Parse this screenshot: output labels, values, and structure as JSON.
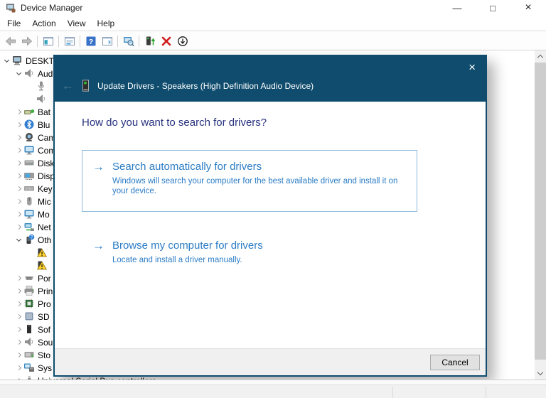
{
  "titlebar": {
    "title": "Device Manager",
    "app_icon": "device-manager-icon",
    "minimize_glyph": "—",
    "maximize_glyph": "□",
    "close_glyph": "×"
  },
  "menubar": {
    "items": [
      "File",
      "Action",
      "View",
      "Help"
    ]
  },
  "toolbar": {
    "buttons": [
      {
        "icon": "back-arrow-icon",
        "disabled": true
      },
      {
        "icon": "forward-arrow-icon",
        "disabled": true
      },
      {
        "sep": true
      },
      {
        "icon": "console-tree-icon"
      },
      {
        "sep": true
      },
      {
        "icon": "properties-icon"
      },
      {
        "sep": true
      },
      {
        "icon": "help-icon"
      },
      {
        "icon": "action-pane-icon"
      },
      {
        "sep": true
      },
      {
        "icon": "scan-hardware-icon"
      },
      {
        "sep": true
      },
      {
        "icon": "update-driver-icon"
      },
      {
        "icon": "uninstall-device-icon"
      },
      {
        "icon": "disable-device-icon"
      }
    ]
  },
  "tree": {
    "items": [
      {
        "label": "DESKTO",
        "icon": "computer-icon",
        "depth": 0,
        "expander": "open"
      },
      {
        "label": "Aud",
        "icon": "speaker-icon",
        "depth": 1,
        "expander": "open"
      },
      {
        "label": "",
        "icon": "microphone-icon",
        "depth": 2,
        "expander": "none"
      },
      {
        "label": "",
        "icon": "speaker-icon",
        "depth": 2,
        "expander": "none"
      },
      {
        "label": "Bat",
        "icon": "battery-icon",
        "depth": 1,
        "expander": "closed"
      },
      {
        "label": "Blu",
        "icon": "bluetooth-icon",
        "depth": 1,
        "expander": "closed"
      },
      {
        "label": "Cam",
        "icon": "camera-icon",
        "depth": 1,
        "expander": "closed"
      },
      {
        "label": "Com",
        "icon": "monitor-icon",
        "depth": 1,
        "expander": "closed"
      },
      {
        "label": "Disk",
        "icon": "disk-icon",
        "depth": 1,
        "expander": "closed"
      },
      {
        "label": "Disp",
        "icon": "display-adapter-icon",
        "depth": 1,
        "expander": "closed"
      },
      {
        "label": "Key",
        "icon": "keyboard-icon",
        "depth": 1,
        "expander": "closed"
      },
      {
        "label": "Mic",
        "icon": "mouse-icon",
        "depth": 1,
        "expander": "closed"
      },
      {
        "label": "Mo",
        "icon": "monitor-icon",
        "depth": 1,
        "expander": "closed"
      },
      {
        "label": "Net",
        "icon": "network-icon",
        "depth": 1,
        "expander": "closed"
      },
      {
        "label": "Oth",
        "icon": "other-device-icon",
        "depth": 1,
        "expander": "open"
      },
      {
        "label": "",
        "icon": "warning-device-icon",
        "depth": 2,
        "expander": "none"
      },
      {
        "label": "",
        "icon": "warning-device-icon",
        "depth": 2,
        "expander": "none"
      },
      {
        "label": "Por",
        "icon": "serial-port-icon",
        "depth": 1,
        "expander": "closed"
      },
      {
        "label": "Prin",
        "icon": "printer-icon",
        "depth": 1,
        "expander": "closed"
      },
      {
        "label": "Pro",
        "icon": "processor-icon",
        "depth": 1,
        "expander": "closed"
      },
      {
        "label": "SD",
        "icon": "sd-card-icon",
        "depth": 1,
        "expander": "closed"
      },
      {
        "label": "Sof",
        "icon": "software-device-icon",
        "depth": 1,
        "expander": "closed"
      },
      {
        "label": "Sou",
        "icon": "speaker-icon",
        "depth": 1,
        "expander": "closed"
      },
      {
        "label": "Sto",
        "icon": "storage-icon",
        "depth": 1,
        "expander": "closed"
      },
      {
        "label": "Sys",
        "icon": "system-icon",
        "depth": 1,
        "expander": "closed"
      },
      {
        "label": "Universal Serial Bus controllers",
        "icon": "usb-icon",
        "depth": 1,
        "expander": "closed"
      }
    ]
  },
  "dialog": {
    "back_glyph": "←",
    "close_glyph": "×",
    "title_icon": "driver-device-icon",
    "title": "Update Drivers - Speakers (High Definition Audio Device)",
    "heading": "How do you want to search for drivers?",
    "options": [
      {
        "arrow_glyph": "→",
        "title": "Search automatically for drivers",
        "desc": "Windows will search your computer for the best available driver and install it on your device."
      },
      {
        "arrow_glyph": "→",
        "title": "Browse my computer for drivers",
        "desc": "Locate and install a driver manually."
      }
    ],
    "cancel_label": "Cancel"
  },
  "colors": {
    "wizard_header": "#0f4c6d",
    "link_blue": "#2b7cc5",
    "heading_blue": "#28327e",
    "option_border": "#8cb8da",
    "warning_yellow": "#ffd32a",
    "uninstall_red": "#cf1a1a"
  }
}
